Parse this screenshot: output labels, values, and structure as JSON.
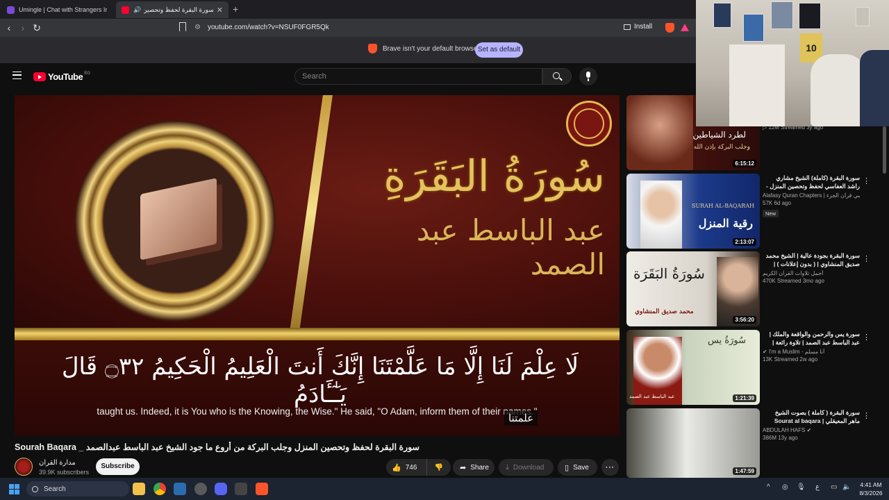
{
  "browser": {
    "tabs": [
      {
        "title": "Umingle | Chat with Strangers Instant",
        "active": false
      },
      {
        "title": "سورة البقرة لحفظ وتحصين المنـ",
        "active": true
      }
    ],
    "url": "youtube.com/watch?v=NSUF0FGR5Qk",
    "install_label": "Install",
    "infobar_text": "Brave isn't your default browser",
    "set_default_label": "Set as default"
  },
  "youtube": {
    "logo_text": "YouTube",
    "region": "EG",
    "search_placeholder": "Search"
  },
  "video": {
    "frame_title": "سُورَةُ البَقَرَةِ",
    "frame_reciter": "عبد الباسط عبد الصمد",
    "frame_ayah": "لَا عِلْمَ لَنَا إِلَّا مَا عَلَّمْتَنَا إِنَّكَ أَنتَ الْعَلِيمُ الْحَكِيمُ ۝٣٢ قَالَ يَـٰٓـَٔادَمُ",
    "frame_translation": "taught us. Indeed, it is You who is the Knowing, the Wise.\" He said, \"O Adam, inform them of their names.\"",
    "caption": "علمتنا",
    "title": "سورة البقرة لحفظ وتحصين المنزل وجلب البركة من أروع ما جود الشيخ عبد الباسط عبدالصمد _ Sourah Baqara",
    "channel": "مدارة القران",
    "subscribers": "39.9K subscribers",
    "subscribe_label": "Subscribe",
    "likes": "746",
    "share_label": "Share",
    "download_label": "Download",
    "save_label": "Save"
  },
  "sidebar": [
    {
      "title": "",
      "channel": "",
      "stats": "12M  Streamed 3y ago",
      "duration": "6:15:12",
      "badge": "",
      "thumb_text": "لطرد الشياطين",
      "thumb_sub": "وجلب البركة بإذن الله"
    },
    {
      "title": "سورة البقرة (كاملة) الشيخ مشاري راشد العفاسي لحفظ وتحصين المنزل -Surah Al...",
      "channel": "Alafasy Quran Chapters | العفاسي قرآن الجزء",
      "stats": "57K  6d ago",
      "duration": "2:13:07",
      "badge": "New",
      "thumb_text": "رقية المنزل",
      "thumb_sub": "SURAH AL-BAQARAH"
    },
    {
      "title": "سورة البقرة بجودة عالية | الشيخ محمد صديق المنشاوي | ( بدون إعلانات ) | Surah Al-...",
      "channel": "أجمل تلاوات القرآن الكريم",
      "stats": "470K  Streamed 3mo ago",
      "duration": "3:56:20",
      "badge": "",
      "thumb_text": "سُورَةُ البَقَرَة",
      "thumb_sub": "محمد صديق المنشاوي"
    },
    {
      "title": "سورة يس والرحمن والواقعة والملك | عبد الباسط عبد الصمد | تلاوة رائعة | HD...",
      "channel": "I'm a Muslim - أنا مسلم",
      "stats": "13K  Streamed 2w ago",
      "duration": "1:21:39",
      "badge": "",
      "thumb_text": "سُورَةُ يس",
      "thumb_sub": "عبد الباسط عبد الصمد"
    },
    {
      "title": "سورة البقرة ( كاملة ) بصوت الشيخ ماهر المعيقلي | Sourat al baqara maher...",
      "channel": "ABDULAH HAFS",
      "stats": "386M  13y ago",
      "duration": "1:47:59",
      "badge": "",
      "thumb_text": "",
      "thumb_sub": ""
    }
  ],
  "taskbar": {
    "search_label": "Search",
    "time": "4:41 AM",
    "date": "8/3/2026",
    "lang": "ع"
  },
  "colors": {
    "yt_red": "#ff0033",
    "brave_orange": "#fb542b",
    "set_default_bg": "#b7b4ff",
    "gold": "#e4c25c"
  }
}
